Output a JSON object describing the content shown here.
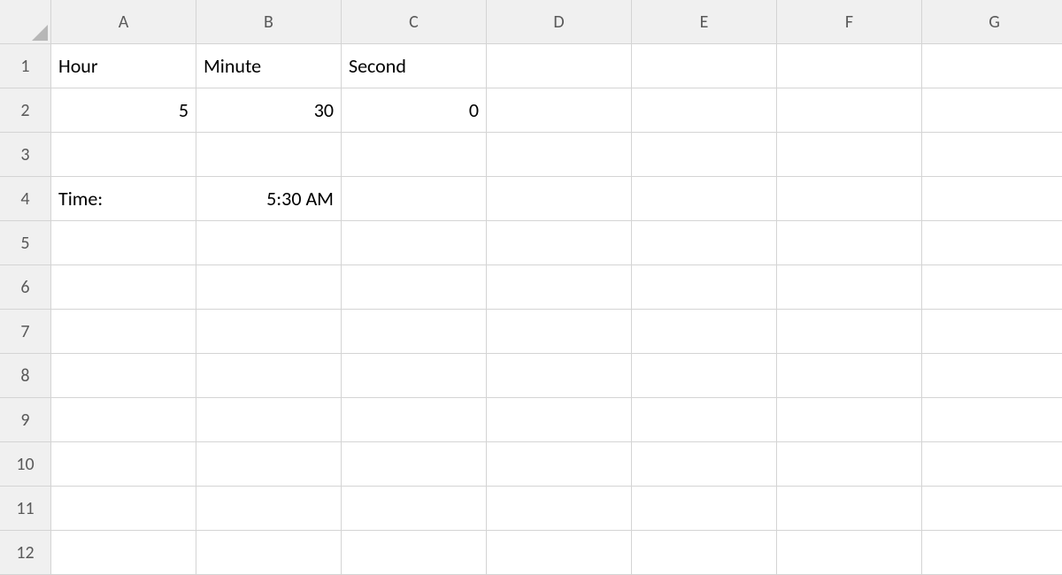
{
  "columns": [
    "A",
    "B",
    "C",
    "D",
    "E",
    "F",
    "G"
  ],
  "rows": [
    "1",
    "2",
    "3",
    "4",
    "5",
    "6",
    "7",
    "8",
    "9",
    "10",
    "11",
    "12"
  ],
  "cells": {
    "A1": {
      "value": "Hour",
      "align": "left"
    },
    "B1": {
      "value": "Minute",
      "align": "left"
    },
    "C1": {
      "value": "Second",
      "align": "left"
    },
    "A2": {
      "value": "5",
      "align": "right"
    },
    "B2": {
      "value": "30",
      "align": "right"
    },
    "C2": {
      "value": "0",
      "align": "right"
    },
    "A4": {
      "value": "Time:",
      "align": "left"
    },
    "B4": {
      "value": "5:30 AM",
      "align": "right"
    }
  }
}
